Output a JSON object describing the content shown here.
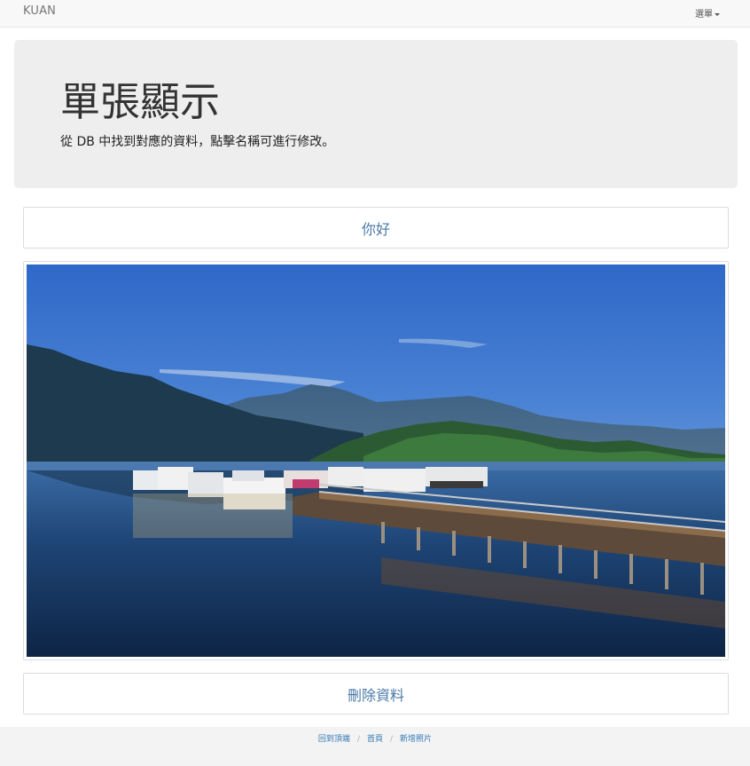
{
  "navbar": {
    "brand": "KUAN",
    "menu_label": "選單"
  },
  "jumbotron": {
    "title": "單張顯示",
    "description": "從 DB 中找到對應的資料，點擊名稱可進行修改。"
  },
  "record": {
    "name": "你好",
    "delete_label": "刪除資料"
  },
  "footer": {
    "links": [
      "回到頂端",
      "首頁",
      "新增照片"
    ]
  },
  "colors": {
    "link": "#4a7aa8",
    "jumbotron_bg": "#eeeeee"
  }
}
